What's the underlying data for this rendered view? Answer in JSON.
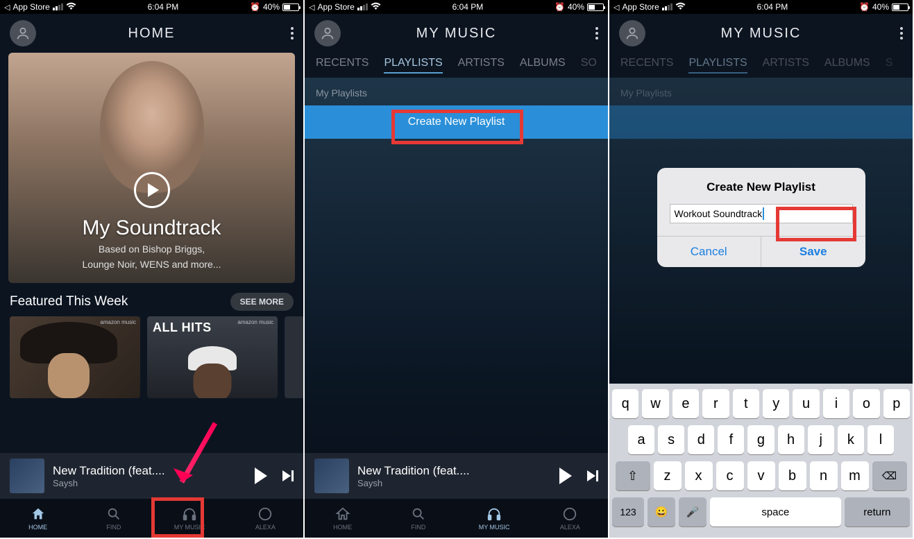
{
  "status": {
    "back_label": "App Store",
    "time": "6:04 PM",
    "alarm_icon": "alarm",
    "battery_pct": "40%"
  },
  "screen1": {
    "header_title": "HOME",
    "hero": {
      "title": "My Soundtrack",
      "subtitle_l1": "Based on Bishop Briggs,",
      "subtitle_l2": "Lounge Noir, WENS and more..."
    },
    "featured_title": "Featured This Week",
    "see_more": "SEE MORE",
    "albums": [
      {
        "badge": "amazon music",
        "text": ""
      },
      {
        "badge": "amazon music",
        "text": "ALL HITS"
      }
    ],
    "nav": {
      "home": "HOME",
      "find": "FIND",
      "mymusic": "MY MUSIC",
      "alexa": "ALEXA"
    }
  },
  "now_playing": {
    "title": "New Tradition (feat....",
    "artist": "Saysh"
  },
  "screen2": {
    "header_title": "MY MUSIC",
    "tabs": [
      "RECENTS",
      "PLAYLISTS",
      "ARTISTS",
      "ALBUMS",
      "SO"
    ],
    "active_tab": 1,
    "section_label": "My Playlists",
    "create_label": "Create New Playlist",
    "nav": {
      "home": "HOME",
      "find": "FIND",
      "mymusic": "MY MUSIC",
      "alexa": "ALEXA"
    }
  },
  "screen3": {
    "header_title": "MY MUSIC",
    "tabs": [
      "RECENTS",
      "PLAYLISTS",
      "ARTISTS",
      "ALBUMS",
      "S"
    ],
    "section_label": "My Playlists",
    "dialog": {
      "title": "Create New Playlist",
      "input_value": "Workout Soundtrack",
      "cancel": "Cancel",
      "save": "Save"
    },
    "keyboard": {
      "row1": [
        "q",
        "w",
        "e",
        "r",
        "t",
        "y",
        "u",
        "i",
        "o",
        "p"
      ],
      "row2": [
        "a",
        "s",
        "d",
        "f",
        "g",
        "h",
        "j",
        "k",
        "l"
      ],
      "row3": [
        "z",
        "x",
        "c",
        "v",
        "b",
        "n",
        "m"
      ],
      "shift": "⇧",
      "backspace": "⌫",
      "num": "123",
      "emoji": "😀",
      "mic": "🎤",
      "space": "space",
      "return": "return"
    }
  }
}
